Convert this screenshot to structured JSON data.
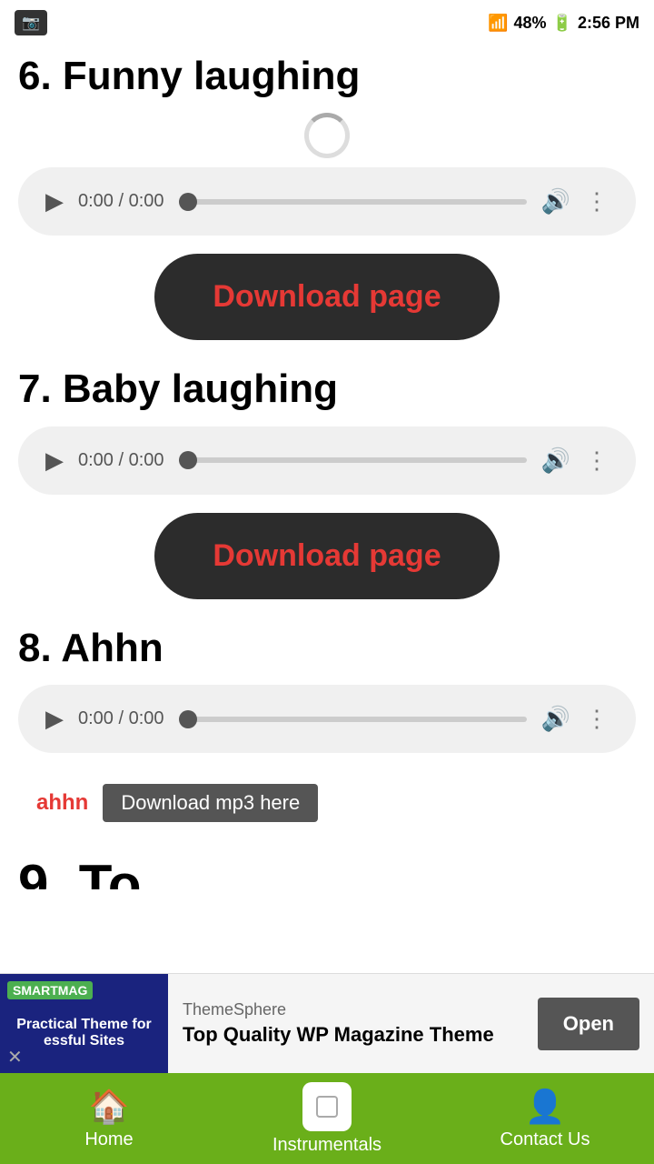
{
  "statusBar": {
    "time": "2:56 PM",
    "battery": "48%",
    "network": "4G"
  },
  "tracks": [
    {
      "id": 6,
      "title": "6. Funny laughing",
      "time": "0:00 / 0:00",
      "downloadLabel": "Download page",
      "showSpinner": true
    },
    {
      "id": 7,
      "title": "7. Baby laughing",
      "time": "0:00 / 0:00",
      "downloadLabel": "Download page",
      "showSpinner": false
    },
    {
      "id": 8,
      "title": "8. Ahhn",
      "time": "0:00 / 0:00",
      "downloadLabel": null,
      "showSpinner": false
    }
  ],
  "ahhnRow": {
    "text": "ahhn",
    "buttonLabel": "Download mp3 here"
  },
  "nextTrackPartial": "9. To...",
  "ad": {
    "badge": "SMARTMAG",
    "imageText": "Practical Theme for essful Sites",
    "brand": "ThemeSphere",
    "title": "Top Quality WP Magazine Theme",
    "openLabel": "Open"
  },
  "bottomNav": {
    "items": [
      {
        "id": "home",
        "label": "Home",
        "icon": "🏠"
      },
      {
        "id": "instrumentals",
        "label": "Instrumentals",
        "icon": "□"
      },
      {
        "id": "contact",
        "label": "Contact Us",
        "icon": "👤"
      }
    ]
  }
}
